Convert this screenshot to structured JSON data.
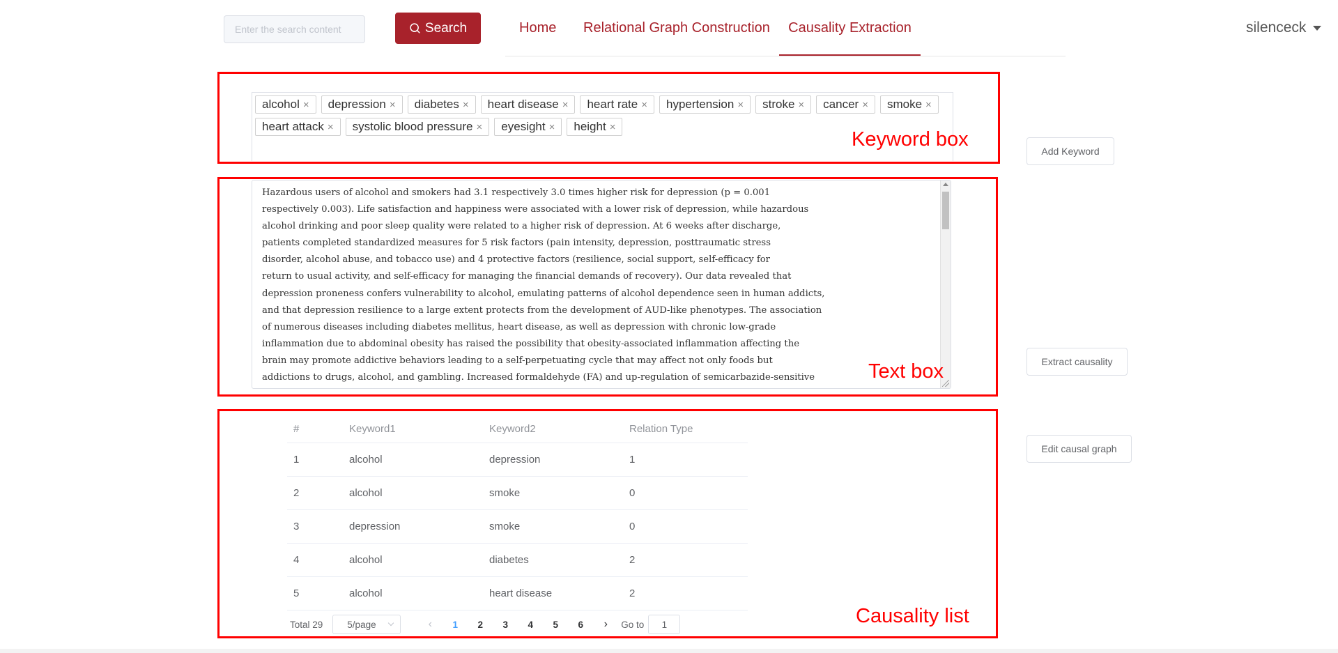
{
  "header": {
    "search_placeholder": "Enter the search content",
    "search_button_label": "Search",
    "nav": [
      {
        "label": "Home"
      },
      {
        "label": "Relational Graph Construction"
      },
      {
        "label": "Causality Extraction",
        "active": true
      }
    ],
    "username": "silenceck"
  },
  "annotations": {
    "keyword_box": "Keyword box",
    "text_box": "Text box",
    "causality_list": "Causality list"
  },
  "keywords": [
    "alcohol",
    "depression",
    "diabetes",
    "heart disease",
    "heart rate",
    "hypertension",
    "stroke",
    "cancer",
    "smoke",
    "heart attack",
    "systolic blood pressure",
    "eyesight",
    "height"
  ],
  "tag_close_glyph": "×",
  "text_box": {
    "content": "Hazardous users of alcohol and smokers had 3.1 respectively 3.0 times higher risk for depression (p = 0.001\nrespectively 0.003). Life satisfaction and happiness were associated with a lower risk of depression, while hazardous\nalcohol drinking and poor sleep quality were related to a higher risk of depression. At 6 weeks after discharge,\npatients completed standardized measures for 5 risk factors (pain intensity, depression, posttraumatic stress\ndisorder, alcohol abuse, and tobacco use) and 4 protective factors (resilience, social support, self-efficacy for\nreturn to usual activity, and self-efficacy for managing the financial demands of recovery). Our data revealed that\ndepression proneness confers vulnerability to alcohol, emulating patterns of alcohol dependence seen in human addicts,\nand that depression resilience to a large extent protects from the development of AUD-like phenotypes. The association\nof numerous diseases including diabetes mellitus, heart disease, as well as depression with chronic low-grade\ninflammation due to abdominal obesity has raised the possibility that obesity-associated inflammation affecting the\nbrain may promote addictive behaviors leading to a self-perpetuating cycle that may affect not only foods but\naddictions to drugs, alcohol, and gambling. Increased formaldehyde (FA) and up-regulation of semicarbazide-sensitive"
  },
  "table": {
    "headers": [
      "#",
      "Keyword1",
      "Keyword2",
      "Relation Type"
    ],
    "rows": [
      [
        "1",
        "alcohol",
        "depression",
        "1"
      ],
      [
        "2",
        "alcohol",
        "smoke",
        "0"
      ],
      [
        "3",
        "depression",
        "smoke",
        "0"
      ],
      [
        "4",
        "alcohol",
        "diabetes",
        "2"
      ],
      [
        "5",
        "alcohol",
        "heart disease",
        "2"
      ]
    ]
  },
  "pagination": {
    "total": "Total 29",
    "page_size": "5/page",
    "pages": [
      "1",
      "2",
      "3",
      "4",
      "5",
      "6"
    ],
    "current_page": "1",
    "goto_label": "Go to",
    "goto_value": "1",
    "prev_glyph": "‹",
    "next_glyph": "›"
  },
  "buttons": {
    "add_keyword": "Add Keyword",
    "extract_causality": "Extract causality",
    "edit_causal_graph": "Edit causal graph"
  },
  "colors": {
    "brand": "#a8222b",
    "annotation": "#ff0000",
    "pagination_active": "#409eff"
  }
}
